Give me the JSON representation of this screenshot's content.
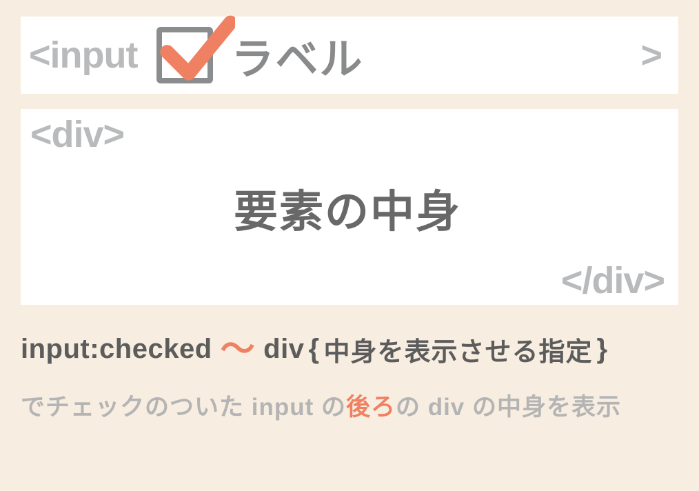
{
  "row1": {
    "open_tag": "<input",
    "label": "ラベル",
    "close_tag": ">"
  },
  "row2": {
    "open_tag": "<div>",
    "content": "要素の中身",
    "close_tag": "</div>"
  },
  "caption1": {
    "selector_left": "input:checked",
    "tilde": "〜",
    "selector_right": "div",
    "brace_open": "{",
    "rule_text": "中身を表示させる指定",
    "brace_close": "}"
  },
  "caption2": {
    "part1": "でチェックのついた input の",
    "accent": "後ろ",
    "part2": "の div の中身を表示"
  },
  "colors": {
    "accent": "#ef8062",
    "bg": "#f7ede0",
    "muted": "#b9babc",
    "text": "#5c5c5c"
  }
}
